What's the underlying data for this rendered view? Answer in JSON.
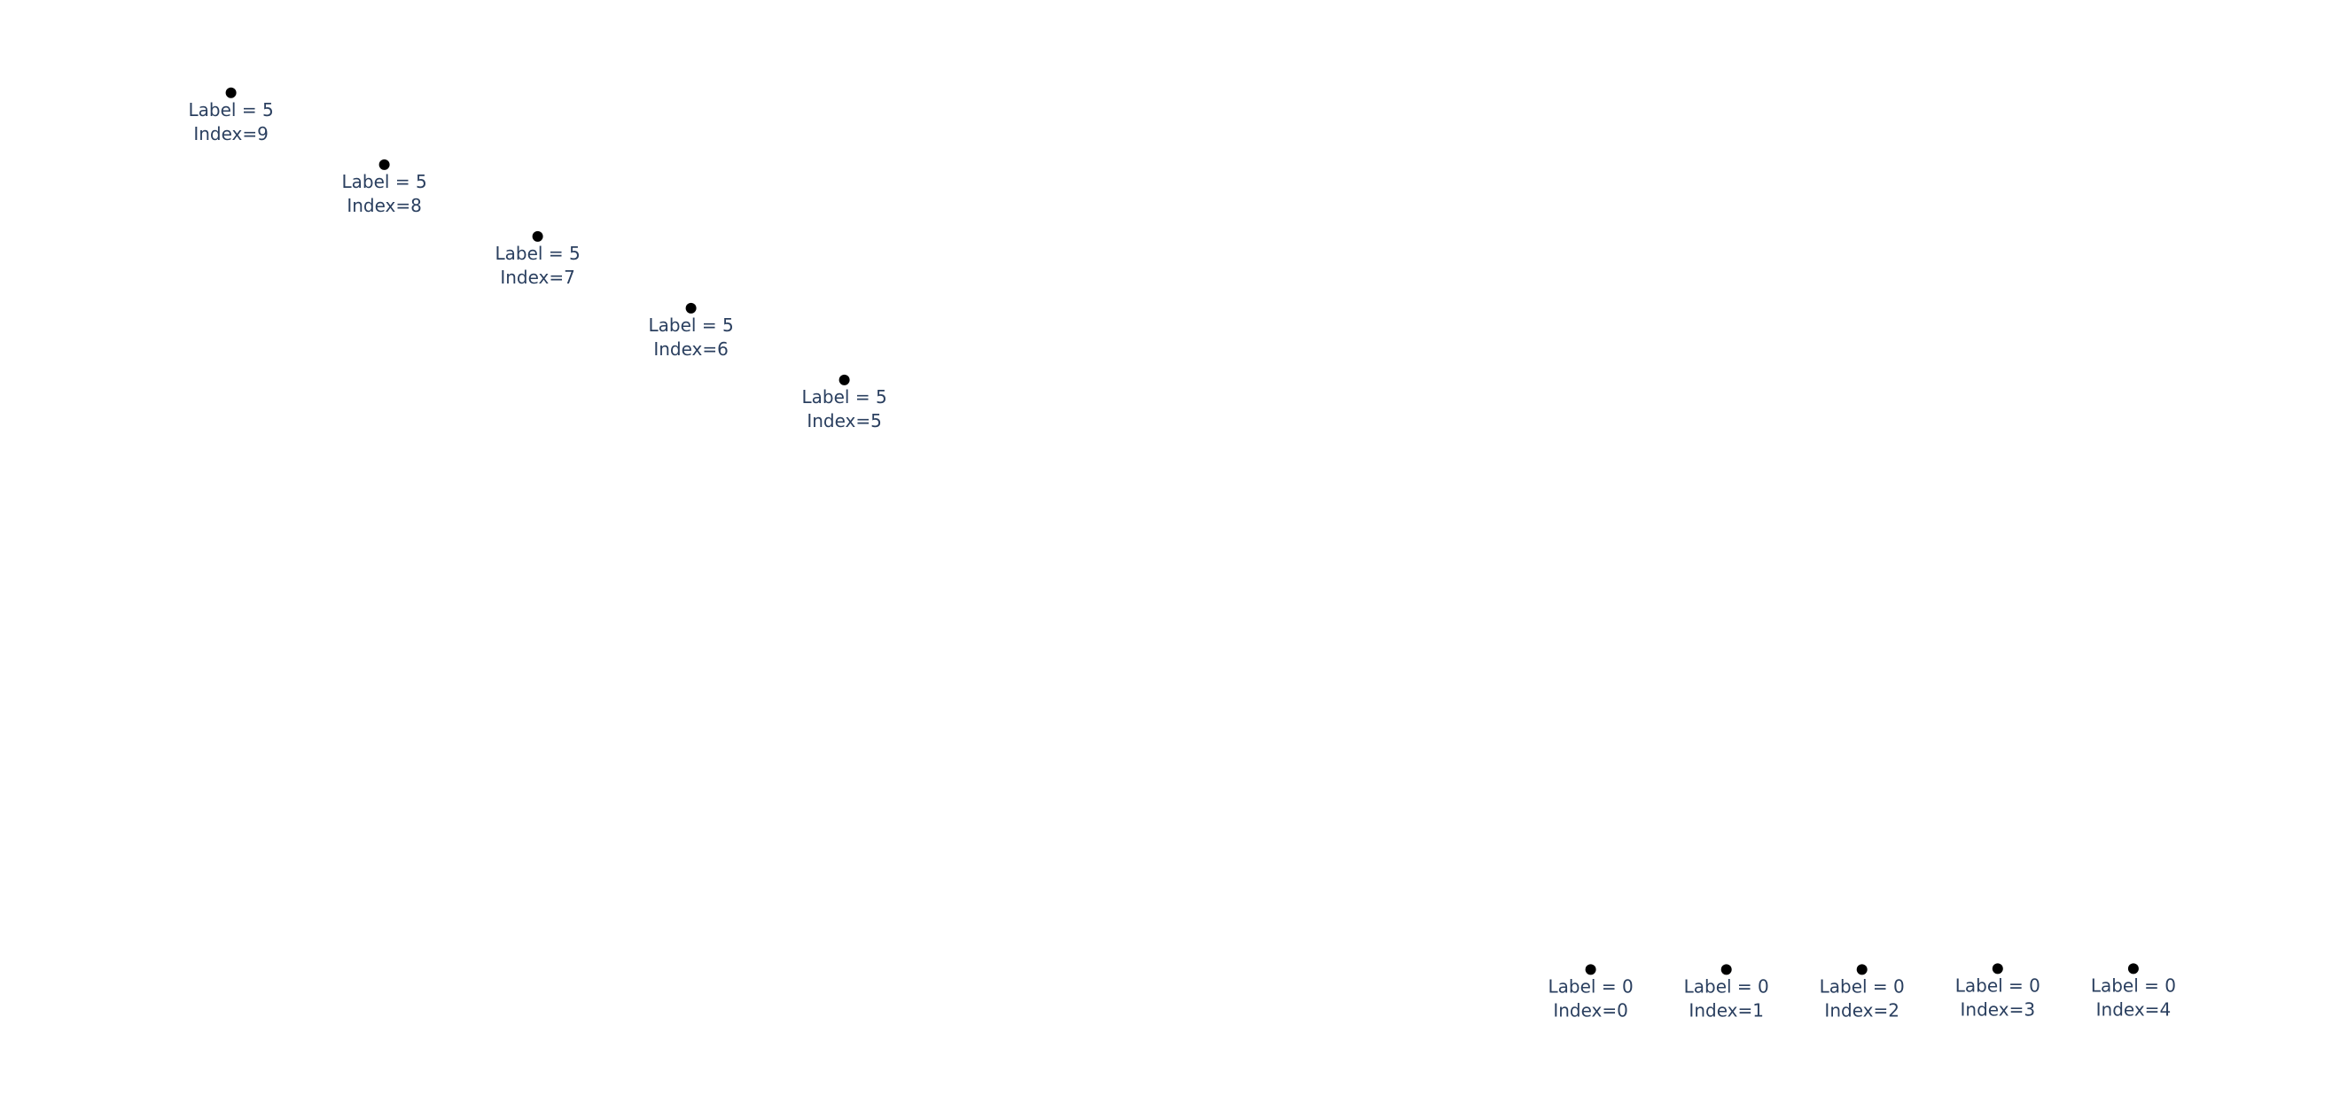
{
  "chart_data": {
    "type": "scatter",
    "title": "",
    "xlabel": "",
    "ylabel": "",
    "grid": false,
    "legend": false,
    "marker_color": "#000000",
    "text_color": "#2a3f5f",
    "points": [
      {
        "index": 0,
        "label": 0,
        "x": 0.5,
        "y": -0.866,
        "text": [
          "Label = 0",
          "Index=0"
        ]
      },
      {
        "index": 1,
        "label": 0,
        "x": 0.6,
        "y": -0.866,
        "text": [
          "Label = 0",
          "Index=1"
        ]
      },
      {
        "index": 2,
        "label": 0,
        "x": 0.7,
        "y": -0.866,
        "text": [
          "Label = 0",
          "Index=2"
        ]
      },
      {
        "index": 3,
        "label": 0,
        "x": 0.8,
        "y": -0.865,
        "text": [
          "Label = 0",
          "Index=3"
        ]
      },
      {
        "index": 4,
        "label": 0,
        "x": 0.9,
        "y": -0.865,
        "text": [
          "Label = 0",
          "Index=4"
        ]
      },
      {
        "index": 5,
        "label": 5,
        "x": -0.05,
        "y": -0.25,
        "text": [
          "Label = 5",
          "Index=5"
        ]
      },
      {
        "index": 6,
        "label": 5,
        "x": -0.163,
        "y": -0.175,
        "text": [
          "Label = 5",
          "Index=6"
        ]
      },
      {
        "index": 7,
        "label": 5,
        "x": -0.276,
        "y": -0.1,
        "text": [
          "Label = 5",
          "Index=7"
        ]
      },
      {
        "index": 8,
        "label": 5,
        "x": -0.389,
        "y": -0.025,
        "text": [
          "Label = 5",
          "Index=8"
        ]
      },
      {
        "index": 9,
        "label": 5,
        "x": -0.502,
        "y": 0.05,
        "text": [
          "Label = 5",
          "Index=9"
        ]
      }
    ],
    "xlim": [
      -0.62,
      1.0
    ],
    "ylim": [
      -0.96,
      0.11
    ]
  }
}
